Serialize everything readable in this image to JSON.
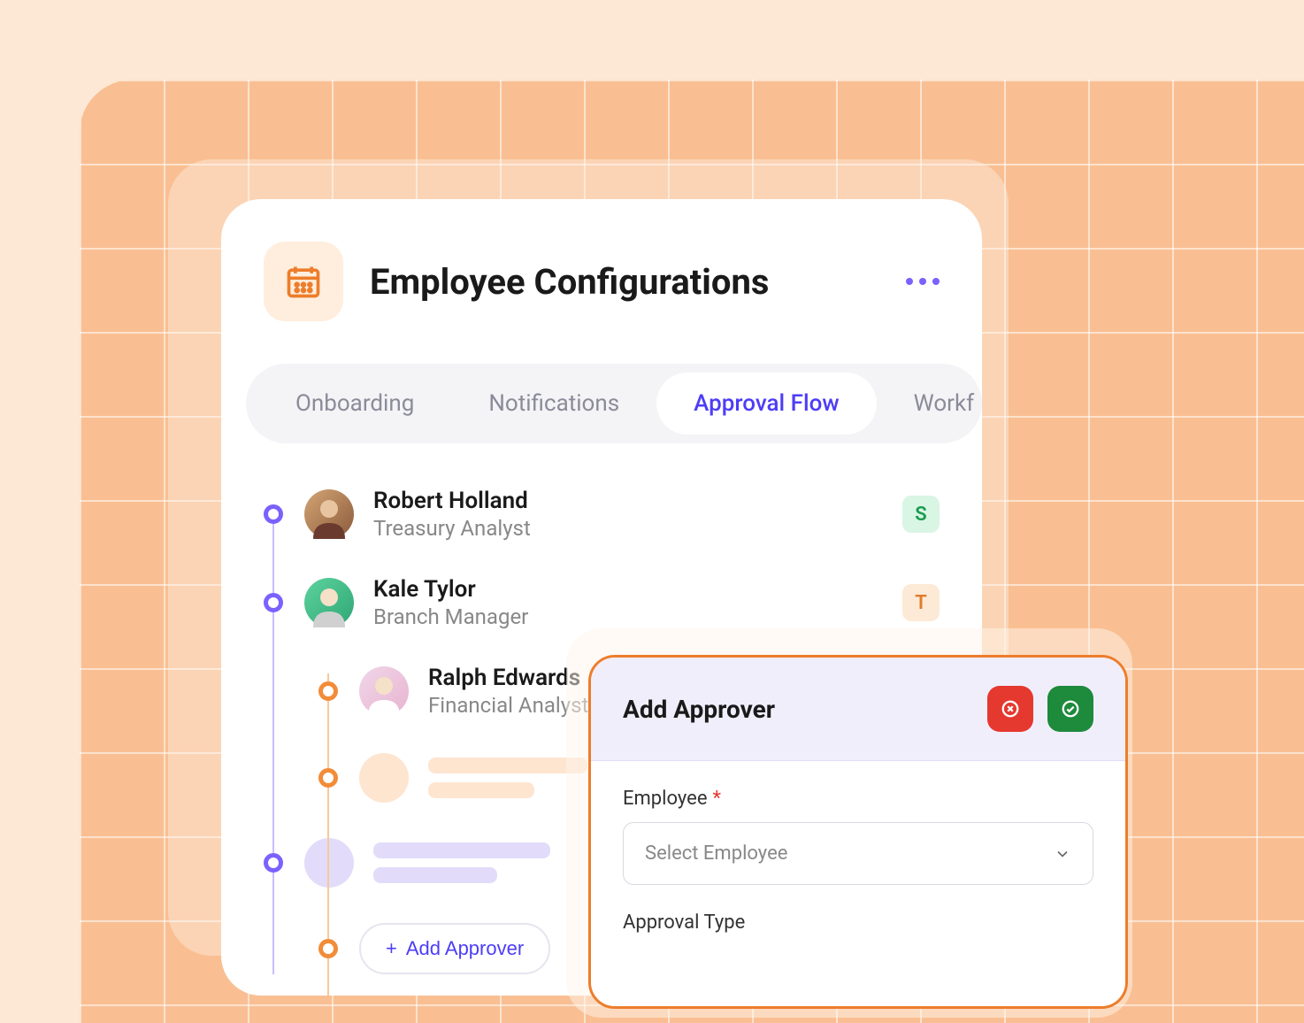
{
  "header": {
    "title": "Employee Configurations"
  },
  "tabs": [
    {
      "label": "Onboarding",
      "active": false
    },
    {
      "label": "Notifications",
      "active": false
    },
    {
      "label": "Approval Flow",
      "active": true
    },
    {
      "label": "Workf",
      "active": false
    }
  ],
  "flow": {
    "nodes": [
      {
        "name": "Robert Holland",
        "role": "Treasury Analyst",
        "badge": "S",
        "badge_color": "s"
      },
      {
        "name": "Kale Tylor",
        "role": "Branch Manager",
        "badge": "T",
        "badge_color": "t"
      }
    ],
    "sub_nodes": [
      {
        "name": "Ralph Edwards",
        "role": "Financial Analyst"
      }
    ],
    "add_button": "Add Approver"
  },
  "modal": {
    "title": "Add Approver",
    "fields": {
      "employee": {
        "label": "Employee",
        "required": true,
        "placeholder": "Select Employee"
      },
      "approval_type": {
        "label": "Approval Type"
      }
    }
  }
}
